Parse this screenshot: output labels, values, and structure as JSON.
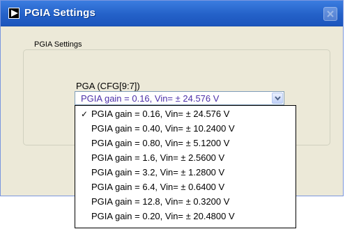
{
  "window": {
    "title": "PGIA Settings",
    "icons": {
      "app": "app-arrow-icon",
      "close": "close-icon"
    }
  },
  "group": {
    "label": "PGIA Settings"
  },
  "pga": {
    "label": "PGA (CFG[9:7])",
    "selected": "PGIA gain = 0.16, Vin= ± 24.576 V",
    "dropdown_icon": "chevron-down-icon",
    "options": [
      {
        "label": "PGIA gain = 0.16, Vin= ± 24.576 V",
        "checked": true
      },
      {
        "label": "PGIA gain = 0.40, Vin= ± 10.2400 V",
        "checked": false
      },
      {
        "label": "PGIA gain = 0.80, Vin= ± 5.1200 V",
        "checked": false
      },
      {
        "label": "PGIA gain = 1.6, Vin= ± 2.5600 V",
        "checked": false
      },
      {
        "label": "PGIA gain = 3.2, Vin= ± 1.2800 V",
        "checked": false
      },
      {
        "label": "PGIA gain = 6.4, Vin= ± 0.6400 V",
        "checked": false
      },
      {
        "label": "PGIA gain = 12.8, Vin= ± 0.3200 V",
        "checked": false
      },
      {
        "label": "PGIA gain = 0.20, Vin= ± 20.4800 V",
        "checked": false
      }
    ]
  }
}
